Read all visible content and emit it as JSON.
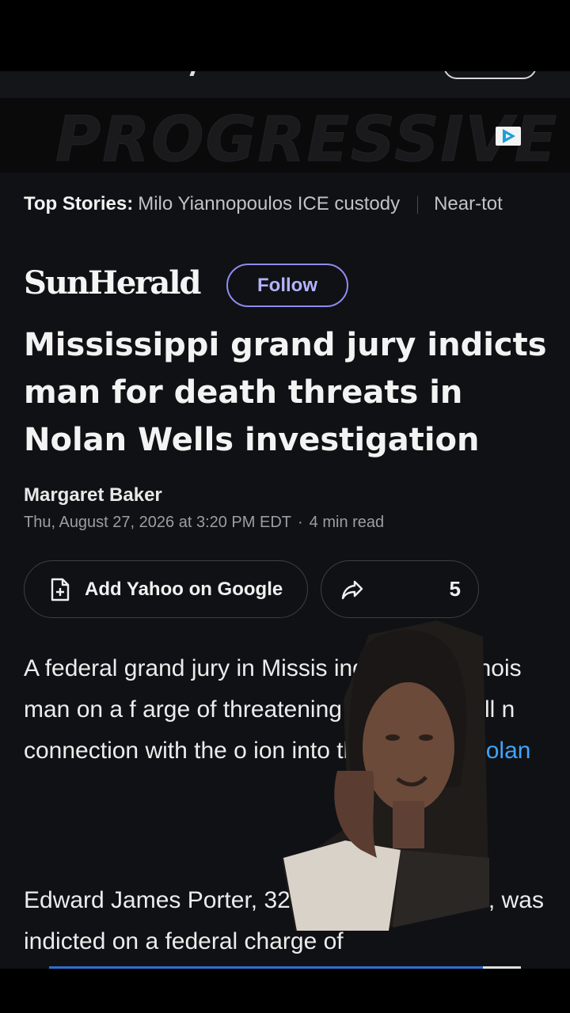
{
  "ad": {
    "brand": "PROGRESSIVE",
    "badge_icon": "adchoices-icon"
  },
  "top_stories": {
    "label": "Top Stories:",
    "items": [
      "Milo Yiannopoulos ICE custody",
      "Near-tot"
    ]
  },
  "publisher": {
    "name": "SunHerald",
    "follow_label": "Follow"
  },
  "article": {
    "headline": "Mississippi grand jury indicts man for death threats in Nolan Wells investigation",
    "author": "Margaret Baker",
    "date": "Thu, August 27, 2026 at 3:20 PM EDT",
    "separator": "·",
    "read_time": "4 min read",
    "paragraph1_before_link": "A federal grand jury in Missis",
    "paragraph1_mid": " indicted an Illinois man on a f       arge of threatening to injure or kill           n connection with the o               ion into the ",
    "paragraph1_link": "death of Nolan",
    "paragraph2": "Edward James Porter, 32, of Berwyn, Illinois, was indicted on a federal charge of"
  },
  "actions": {
    "add_google_label": "Add Yahoo on Google",
    "add_google_icon": "document-plus-icon",
    "share_icon": "share-arrow-icon",
    "share_count": "5"
  },
  "reading_progress": 0.92,
  "colors": {
    "background": "#101114",
    "follow_accent": "#8e8cf2",
    "link": "#3fa4ff",
    "progress": "#2d6fd2"
  }
}
